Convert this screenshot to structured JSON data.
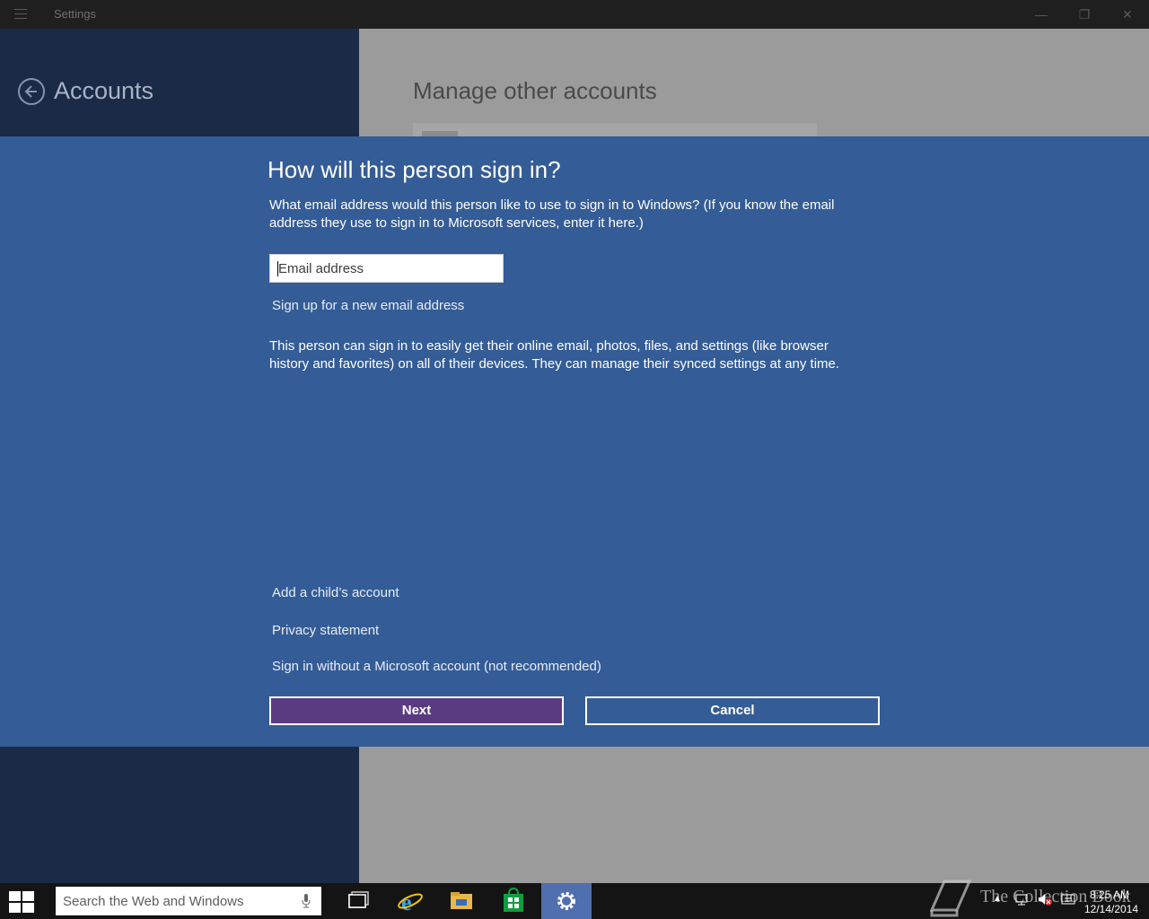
{
  "titlebar": {
    "app_title": "Settings",
    "minimize_glyph": "—",
    "restore_glyph": "❐",
    "close_glyph": "✕"
  },
  "left": {
    "title": "Accounts",
    "back_icon": "back-arrow-circle-icon"
  },
  "right": {
    "title": "Manage other accounts"
  },
  "dialog": {
    "title": "How will this person sign in?",
    "description": "What email address would this person like to use to sign in to Windows? (If you know the email address they use to sign in to Microsoft services, enter it here.)",
    "email_placeholder": "Email address",
    "email_value": "",
    "signup_link": "Sign up for a new email address",
    "info": "This person can sign in to easily get their online email, photos, files, and settings (like browser history and favorites) on all of their devices. They can manage their synced settings at any time.",
    "child_link": "Add a child’s account",
    "privacy_link": "Privacy statement",
    "no_msa_link": "Sign in without a Microsoft account (not recommended)",
    "next_label": "Next",
    "cancel_label": "Cancel",
    "colors": {
      "dialog_bg": "#345c96",
      "next_bg": "#5a3b82"
    }
  },
  "taskbar": {
    "search_placeholder": "Search the Web and Windows",
    "pinned": [
      "task-view-icon",
      "internet-explorer-icon",
      "file-explorer-icon",
      "store-icon",
      "settings-icon"
    ],
    "active_app": "settings-icon",
    "clock_time": "8:25 AM",
    "clock_date": "12/14/2014",
    "watermark": "The Collection Book"
  }
}
